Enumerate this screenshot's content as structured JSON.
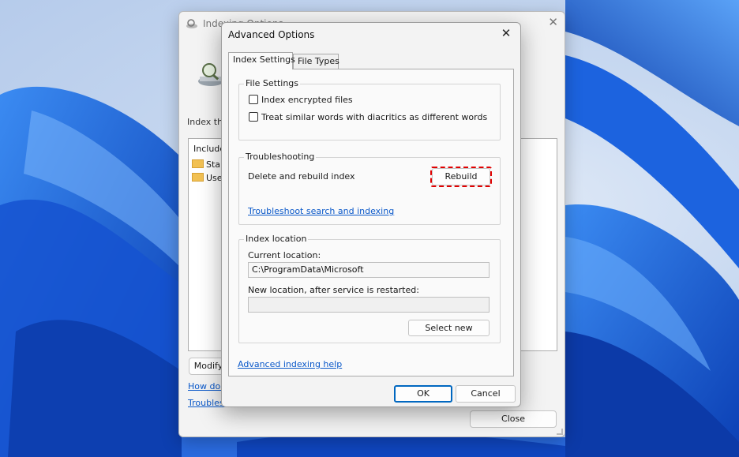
{
  "background_window": {
    "title": "Indexing Options",
    "index_label": "Index these locations:",
    "included_header": "Included Locations",
    "rows": [
      "Start Menu",
      "Users"
    ],
    "modify_label": "Modify",
    "link_1": "How does indexing affect searches?",
    "link_2": "Troubleshoot search and indexing",
    "close_label": "Close",
    "close_glyph": "✕"
  },
  "dialog": {
    "title": "Advanced Options",
    "close_glyph": "✕",
    "tabs": [
      {
        "label": "Index Settings",
        "active": true
      },
      {
        "label": "File Types",
        "active": false
      }
    ],
    "file_settings": {
      "label": "File Settings",
      "options": [
        {
          "label": "Index encrypted files",
          "checked": false
        },
        {
          "label": "Treat similar words with diacritics as different words",
          "checked": false
        }
      ]
    },
    "troubleshooting": {
      "label": "Troubleshooting",
      "delete_rebuild_label": "Delete and rebuild index",
      "rebuild_button": "Rebuild",
      "troubleshoot_link": "Troubleshoot search and indexing"
    },
    "index_location": {
      "label": "Index location",
      "current_label": "Current location:",
      "current_value": "C:\\ProgramData\\Microsoft",
      "new_label": "New location, after service is restarted:",
      "new_value": "",
      "select_new_button": "Select new"
    },
    "advanced_help_link": "Advanced indexing help",
    "ok_button": "OK",
    "cancel_button": "Cancel"
  },
  "colors": {
    "accent": "#0067c0",
    "link": "#0a58c9",
    "highlight": "#e00000",
    "wallpaper_blue": "#1f5fd6"
  }
}
